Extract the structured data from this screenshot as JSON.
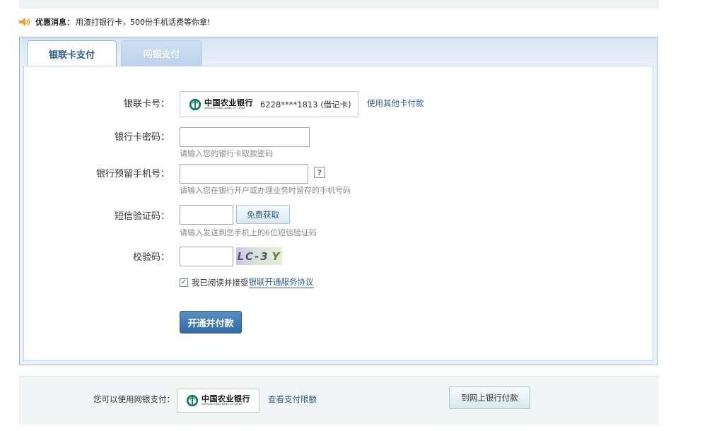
{
  "promo": {
    "bold": "优惠消息：",
    "text": "用渣打银行卡，500份手机话费等你拿!"
  },
  "tabs": [
    {
      "label": "银联卡支付",
      "active": true
    },
    {
      "label": "网银支付",
      "active": false
    }
  ],
  "form": {
    "card_label": "银联卡号：",
    "bank_name": "中国农业银行",
    "bank_name_en": "AGRICULTURAL BANK OF CHINA",
    "card_number": "6228****1813 (借记卡)",
    "other_card_link": "使用其他卡付款",
    "password_label": "银行卡密码：",
    "password_value": "",
    "password_hint": "请输入您的银行卡取款密码",
    "phone_label": "银行预留手机号：",
    "phone_value": "",
    "phone_help": "?",
    "phone_hint": "请输入您在银行开户或办理业务时留存的手机号码",
    "sms_label": "短信验证码：",
    "sms_value": "",
    "sms_button": "免费获取",
    "sms_hint": "请输入发送到您手机上的6位短信验证码",
    "captcha_label": "校验码：",
    "captcha_value": "",
    "captcha_text": "LC-3",
    "captcha_text2": "Y",
    "agree_checked": true,
    "agree_text": "我已阅读并接受",
    "agree_link": "银联开通服务协议",
    "submit_button": "开通并付款"
  },
  "bottom": {
    "label": "您可以使用网银支付：",
    "bank_name": "中国农业银行",
    "bank_name_en": "AGRICULTURAL BANK OF CHINA",
    "limit_link": "查看支付限额",
    "netbank_button": "到网上银行付款"
  },
  "colors": {
    "accent": "#2f5b87",
    "button_blue": "#2f6aa8",
    "bank_green": "#0a7a5a"
  }
}
